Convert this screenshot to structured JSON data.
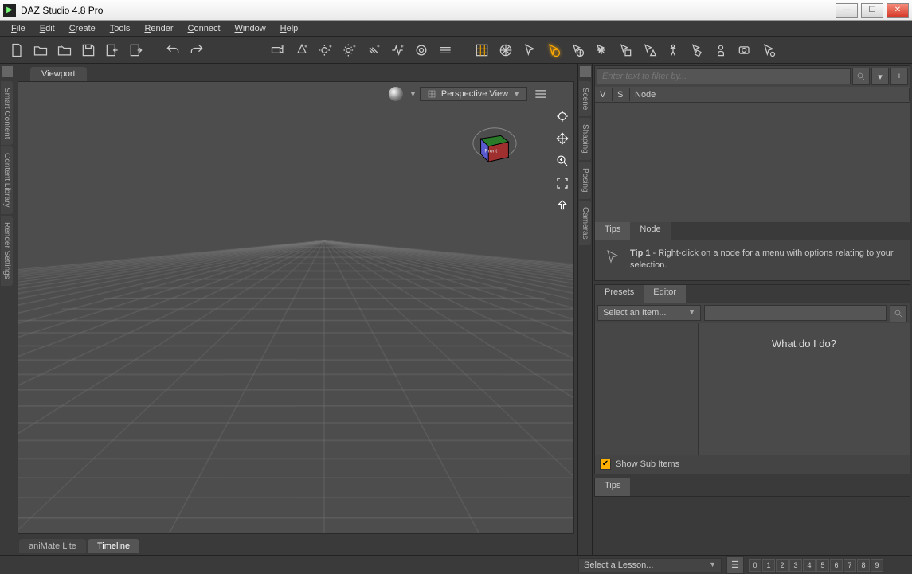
{
  "window": {
    "title": "DAZ Studio 4.8 Pro"
  },
  "menu": {
    "items": [
      "File",
      "Edit",
      "Create",
      "Tools",
      "Render",
      "Connect",
      "Window",
      "Help"
    ]
  },
  "left_tabs": {
    "items": [
      "Smart Content",
      "Content Library",
      "Render Settings"
    ]
  },
  "viewport": {
    "tab": "Viewport",
    "camera_label": "Perspective View",
    "cube_face": "Front"
  },
  "bottom": {
    "tabs": [
      "aniMate Lite",
      "Timeline"
    ],
    "active": 1
  },
  "right_mid_tabs": {
    "items": [
      "Scene",
      "Shaping",
      "Posing",
      "Cameras"
    ]
  },
  "scene": {
    "filter_placeholder": "Enter text to filter by...",
    "cols": {
      "v": "V",
      "s": "S",
      "node": "Node"
    },
    "info_tabs": [
      "Tips",
      "Node"
    ],
    "tip_title": "Tip 1",
    "tip_body": " - Right-click on a node for a menu with options relating to your selection."
  },
  "editor": {
    "tabs": [
      "Presets",
      "Editor"
    ],
    "active": 1,
    "select_label": "Select an Item...",
    "headline": "What do I do?",
    "sub_items_label": "Show Sub Items",
    "bottom_tab": "Tips"
  },
  "status": {
    "lesson": "Select a Lesson...",
    "pages": [
      "0",
      "1",
      "2",
      "3",
      "4",
      "5",
      "6",
      "7",
      "8",
      "9"
    ]
  }
}
